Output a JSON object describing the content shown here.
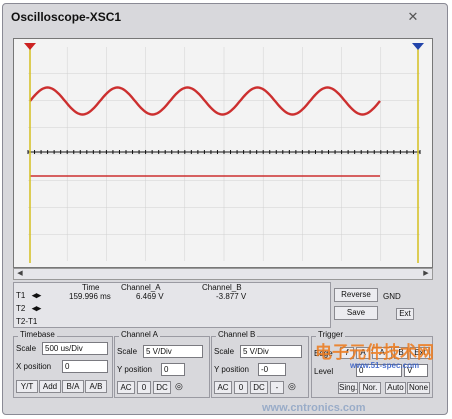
{
  "window": {
    "title": "Oscilloscope-XSC1",
    "close_glyph": "✕"
  },
  "colors": {
    "trace_a": "#cc2f2f",
    "trace_b": "#cc2f2f",
    "grid": "#d0d0d0",
    "cursor_left": "#cc2222",
    "cursor_right": "#2244aa",
    "cursor_line": "#d4c020",
    "axis": "#111111"
  },
  "scope": {
    "cycles": 5,
    "cursor_left_icon": "triangle-down-red",
    "cursor_right_icon": "triangle-down-blue"
  },
  "readout": {
    "col_time": "Time",
    "col_a": "Channel_A",
    "col_b": "Channel_B",
    "t1_label": "T1",
    "t2_label": "T2",
    "t2t1_label": "T2-T1",
    "t1_time": "159.996 ms",
    "t1_a": "6.469 V",
    "t1_b": "-3.877 V",
    "arrows": "◂▸"
  },
  "buttons": {
    "reverse": "Reverse",
    "save": "Save",
    "gnd": "GND",
    "ext": "Ext"
  },
  "timebase": {
    "title": "Timebase",
    "scale_label": "Scale",
    "scale_value": "500 us/Div",
    "xpos_label": "X position",
    "xpos_value": "0",
    "modes": [
      "Y/T",
      "Add",
      "B/A",
      "A/B"
    ]
  },
  "channel_a": {
    "title": "Channel A",
    "scale_label": "Scale",
    "scale_value": "5 V/Div",
    "ypos_label": "Y position",
    "ypos_value": "0",
    "coupling": [
      "AC",
      "0",
      "DC"
    ]
  },
  "channel_b": {
    "title": "Channel B",
    "scale_label": "Scale",
    "scale_value": "5 V/Div",
    "ypos_label": "Y position",
    "ypos_value": "-0",
    "coupling": [
      "AC",
      "0",
      "DC",
      "-"
    ]
  },
  "trigger": {
    "title": "Trigger",
    "edge_label": "Edge",
    "level_label": "Level",
    "level_value": "0",
    "level_unit": "V",
    "edge_buttons": [
      "f",
      "A",
      "B",
      "Ext"
    ],
    "mode_buttons": [
      "Sing.",
      "Nor.",
      "Auto",
      "None"
    ]
  },
  "watermarks": {
    "brand": "电子元件技术网",
    "site_small": "www.51-spec.com",
    "site_bottom": "www.cntronics.com"
  }
}
